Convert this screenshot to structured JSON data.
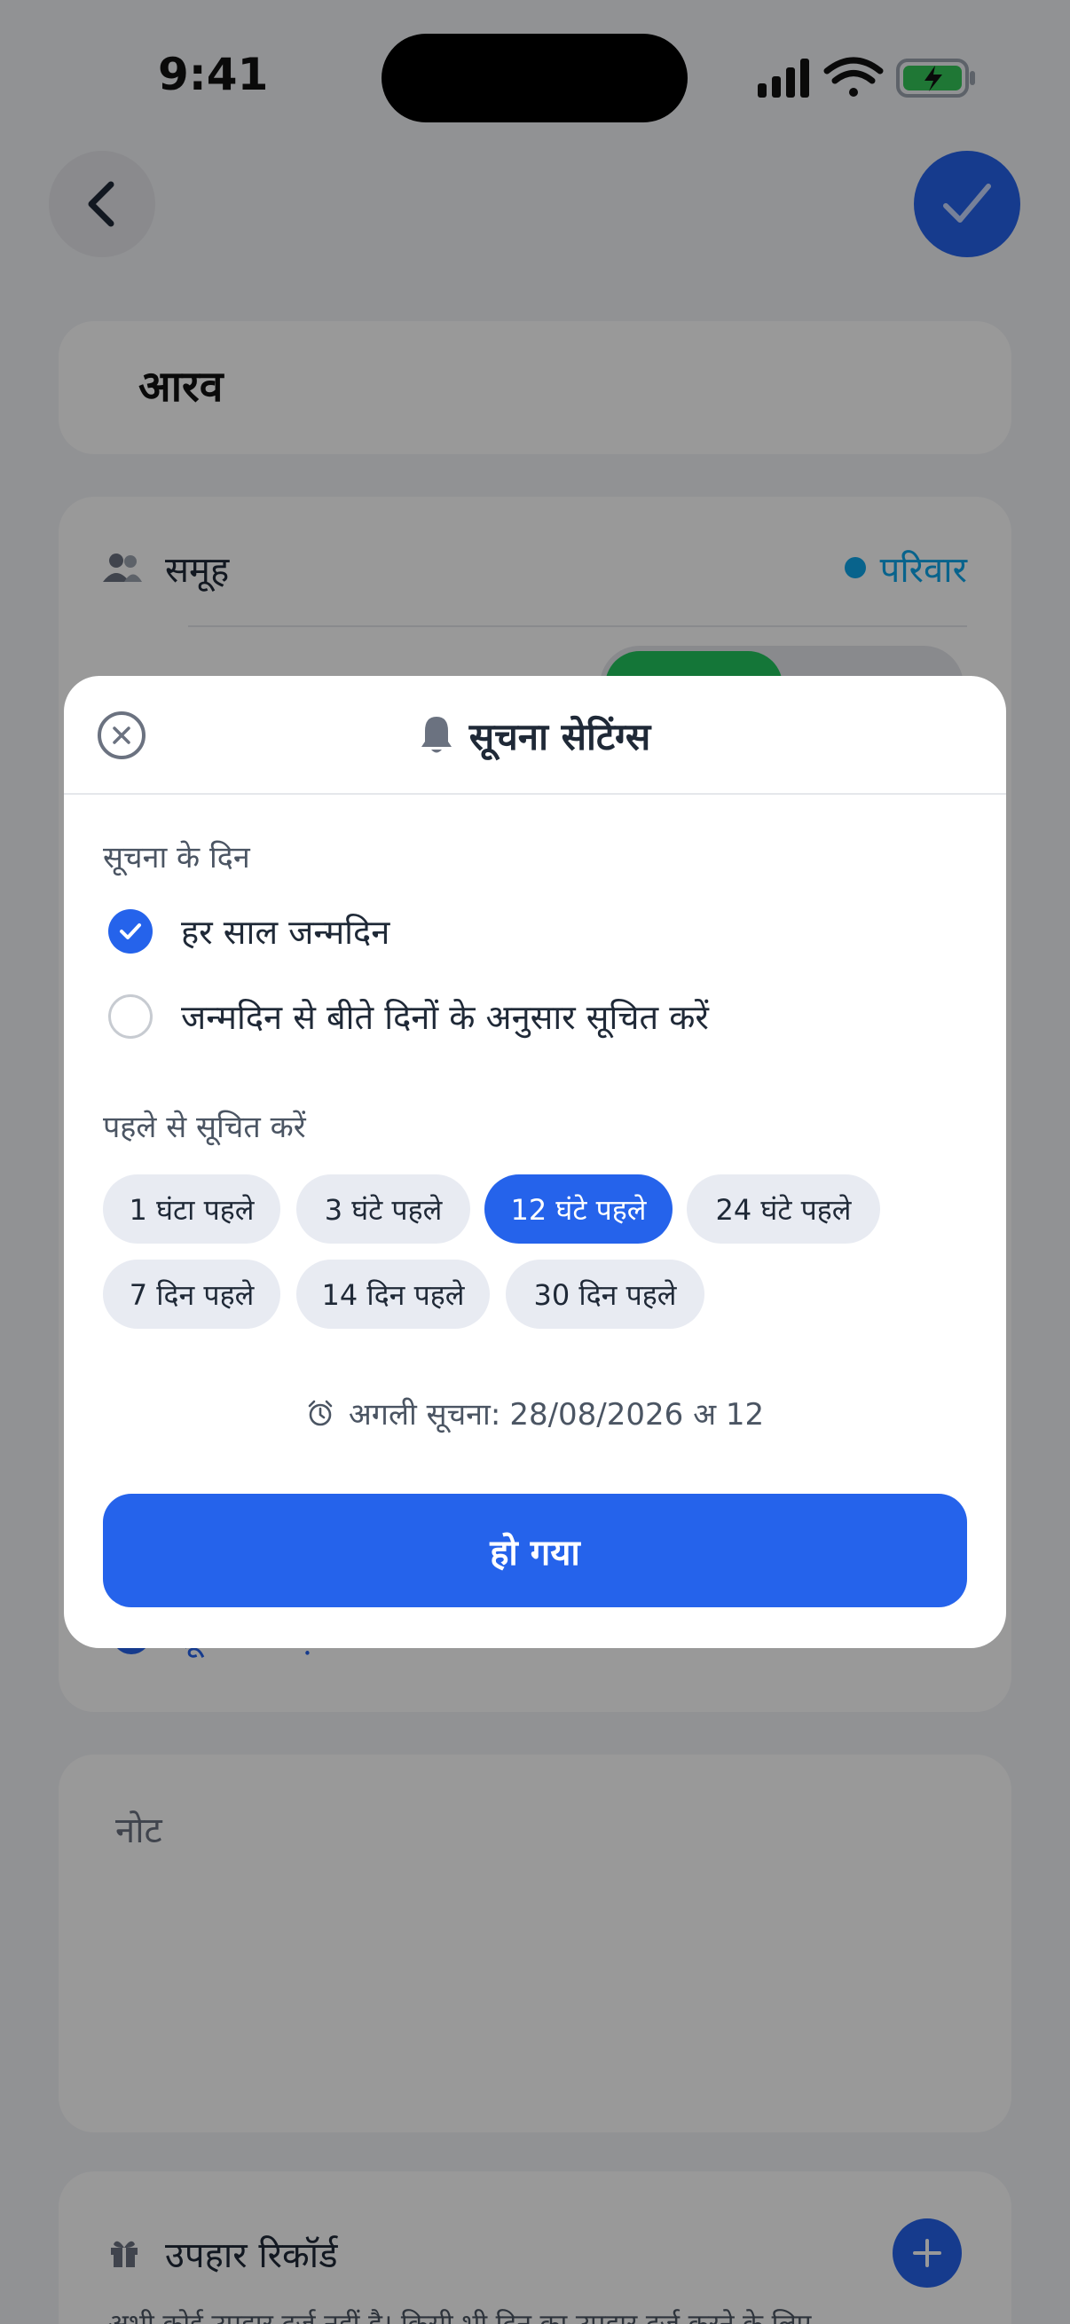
{
  "status_bar": {
    "time": "9:41"
  },
  "contact": {
    "name": "आरव"
  },
  "group": {
    "label": "समूह",
    "value": "परिवार",
    "accent": "#0ea5e9"
  },
  "reminder": {
    "add_label": "सूचना जोड़"
  },
  "notes": {
    "placeholder": "नोट"
  },
  "gifts": {
    "title": "उपहार रिकॉर्ड",
    "empty_text": "अभी कोई उपहार दर्ज नहीं है। किसी भी दिन का उपहार दर्ज करने के लिए"
  },
  "modal": {
    "title": "सूचना सेटिंग्स",
    "days_section_label": "सूचना के दिन",
    "options": [
      {
        "label": "हर साल जन्मदिन",
        "selected": true
      },
      {
        "label": "जन्मदिन से बीते दिनों के अनुसार सूचित करें",
        "selected": false
      }
    ],
    "advance_section_label": "पहले से सूचित करें",
    "chips": [
      {
        "label": "1 घंटा पहले",
        "selected": false
      },
      {
        "label": "3 घंटे पहले",
        "selected": false
      },
      {
        "label": "12 घंटे पहले",
        "selected": true
      },
      {
        "label": "24 घंटे पहले",
        "selected": false
      },
      {
        "label": "7 दिन पहले",
        "selected": false
      },
      {
        "label": "14 दिन पहले",
        "selected": false
      },
      {
        "label": "30 दिन पहले",
        "selected": false
      }
    ],
    "next_label": "अगली सूचना:",
    "next_value": "28/08/2026 अ 12",
    "done_label": "हो गया"
  },
  "colors": {
    "primary": "#2563eb",
    "toggle_on": "#22c55e",
    "overlay": "rgba(0,0,0,0.40)"
  },
  "icons": [
    "back-chevron-icon",
    "checkmark-icon",
    "people-icon",
    "bell-icon",
    "close-icon",
    "alarm-clock-icon",
    "gift-icon",
    "plus-icon",
    "signal-icon",
    "wifi-icon",
    "battery-icon"
  ]
}
